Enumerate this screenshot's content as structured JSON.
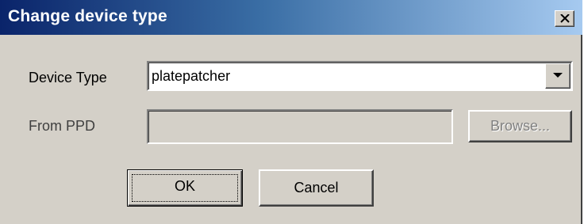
{
  "dialog": {
    "title": "Change device type",
    "close_icon": "close-x-icon"
  },
  "device_type": {
    "label": "Device Type",
    "selected_value": "platepatcher",
    "dropdown_icon": "chevron-down-icon"
  },
  "from_ppd": {
    "label": "From PPD",
    "value": "",
    "enabled": false
  },
  "buttons": {
    "browse_label": "Browse...",
    "ok_label": "OK",
    "cancel_label": "Cancel"
  },
  "colors": {
    "title_gradient_start": "#0a246a",
    "title_gradient_end": "#a6caf0",
    "dialog_face": "#d4d0c8",
    "disabled_text": "#808080"
  }
}
